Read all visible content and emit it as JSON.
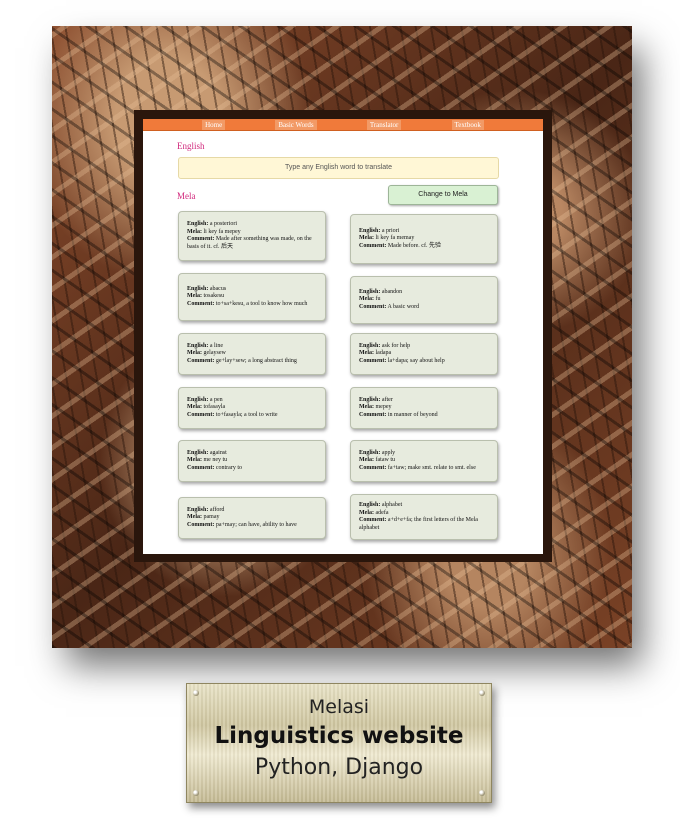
{
  "nav": {
    "items": [
      "Home",
      "Basic Words",
      "Translator",
      "Textbook"
    ]
  },
  "translator": {
    "source_label": "English",
    "input_placeholder": "Type any English word to translate",
    "target_label": "Mela",
    "change_button": "Change to Mela"
  },
  "field_labels": {
    "english": "English:",
    "mela": "Mela:",
    "comment": "Comment:"
  },
  "words": [
    {
      "english": "a posteriori",
      "mela": "li key fa mepey",
      "comment": "Made after something was made, on the basis of it. cf. 后天"
    },
    {
      "english": "a priori",
      "mela": "li key fa memay",
      "comment": "Made before. cf. 先验"
    },
    {
      "english": "abacus",
      "mela": "tosakesu",
      "comment": "to+sa+kesu, a tool to know how much"
    },
    {
      "english": "abandon",
      "mela": "fu",
      "comment": "A basic word"
    },
    {
      "english": "a line",
      "mela": "gelaysew",
      "comment": "ge+lay+sew; a long abstract thing"
    },
    {
      "english": "ask for help",
      "mela": "ladapa",
      "comment": "la+dapa; say about help"
    },
    {
      "english": "a pen",
      "mela": "tofasayla",
      "comment": "to+fasayla; a tool to write"
    },
    {
      "english": "after",
      "mela": "mepey",
      "comment": "in manner of beyond"
    },
    {
      "english": "against",
      "mela": "me ney tu",
      "comment": "contrary to"
    },
    {
      "english": "apply",
      "mela": "fataw tu",
      "comment": "fa+taw; make smt. relate to smt. else"
    },
    {
      "english": "afford",
      "mela": "pamay",
      "comment": "pa+may; can have, ability to have"
    },
    {
      "english": "alphabet",
      "mela": "adefa",
      "comment": "a+d+e+fa; the first letters of the Mela alphabet"
    }
  ],
  "plaque": {
    "line1": "Melasi",
    "line2": "Linguistics website",
    "line3": "Python, Django"
  }
}
